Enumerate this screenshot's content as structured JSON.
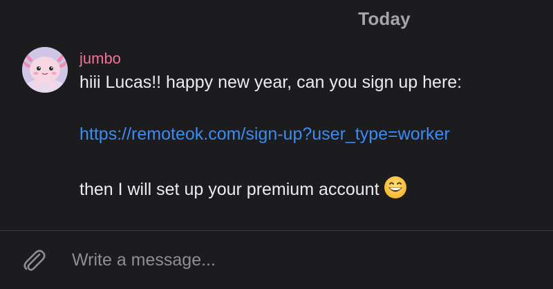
{
  "chat": {
    "date_header": "Today",
    "message": {
      "sender": "jumbo",
      "line_1": "hiii Lucas!! happy new year, can you sign up here:",
      "link": "https://remoteok.com/sign-up?user_type=worker",
      "line_3": "then I will set up your premium account",
      "emoji": "grinning-face-emoji"
    }
  },
  "composer": {
    "placeholder": "Write a message...",
    "attach_icon": "paperclip-icon"
  },
  "colors": {
    "background": "#1c1c1e",
    "sender_name": "#f0739a",
    "link": "#3a8cf5",
    "text": "#ececee",
    "muted": "#8e8e93"
  }
}
